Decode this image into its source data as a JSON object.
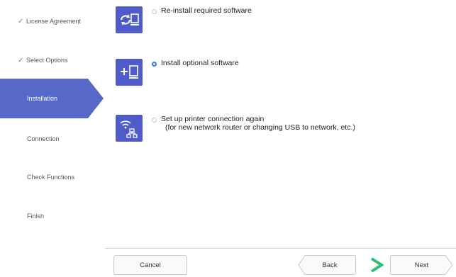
{
  "steps": [
    {
      "label": "License Agreement",
      "state": "done"
    },
    {
      "label": "Select Options",
      "state": "done"
    },
    {
      "label": "Installation",
      "state": "active"
    },
    {
      "label": "Connection",
      "state": "pending"
    },
    {
      "label": "Check Functions",
      "state": "pending"
    },
    {
      "label": "Finish",
      "state": "pending"
    }
  ],
  "options": {
    "reinstall": {
      "label": "Re-install required software",
      "icon": "reinstall-icon",
      "selected": false
    },
    "optional": {
      "label": "Install optional software",
      "icon": "add-software-icon",
      "selected": true
    },
    "printer": {
      "line1": "Set up printer connection again",
      "line2": "(for new network router or changing USB to network, etc.)",
      "icon": "network-icon",
      "selected": false
    }
  },
  "footer": {
    "cancel_label": "Cancel",
    "back_label": "Back",
    "next_label": "Next"
  },
  "colors": {
    "accent": "#5668c8",
    "icon_bg": "#4e5bc9",
    "next_arrow": "#2fbf6f"
  }
}
